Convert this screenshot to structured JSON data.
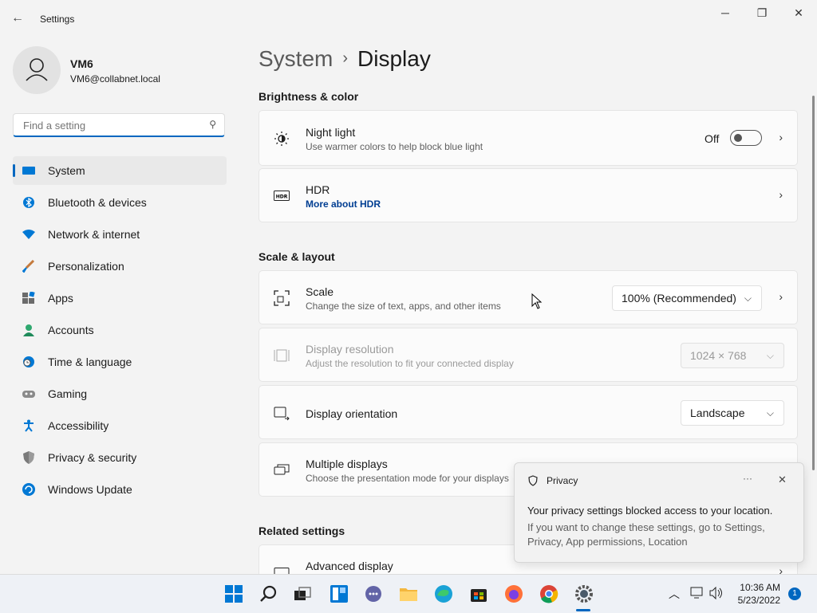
{
  "window": {
    "app_title": "Settings",
    "back_glyph": "←",
    "minimize_glyph": "─",
    "maximize_glyph": "❐",
    "close_glyph": "✕"
  },
  "user": {
    "name": "VM6",
    "email": "VM6@collabnet.local"
  },
  "search": {
    "placeholder": "Find a setting"
  },
  "sidebar": {
    "items": [
      {
        "label": "System",
        "icon": "monitor-icon",
        "selected": true
      },
      {
        "label": "Bluetooth & devices",
        "icon": "bluetooth-icon"
      },
      {
        "label": "Network & internet",
        "icon": "wifi-icon"
      },
      {
        "label": "Personalization",
        "icon": "paintbrush-icon"
      },
      {
        "label": "Apps",
        "icon": "apps-icon"
      },
      {
        "label": "Accounts",
        "icon": "person-icon"
      },
      {
        "label": "Time & language",
        "icon": "clock-globe-icon"
      },
      {
        "label": "Gaming",
        "icon": "gamepad-icon"
      },
      {
        "label": "Accessibility",
        "icon": "accessibility-icon"
      },
      {
        "label": "Privacy & security",
        "icon": "shield-icon"
      },
      {
        "label": "Windows Update",
        "icon": "update-icon"
      }
    ]
  },
  "breadcrumb": {
    "parent": "System",
    "separator": "›",
    "current": "Display"
  },
  "sections": {
    "brightness": "Brightness & color",
    "scale_layout": "Scale & layout",
    "related": "Related settings"
  },
  "cards": {
    "night_light": {
      "title": "Night light",
      "subtitle": "Use warmer colors to help block blue light",
      "state": "Off",
      "on": false
    },
    "hdr": {
      "title": "HDR",
      "link": "More about HDR"
    },
    "scale": {
      "title": "Scale",
      "subtitle": "Change the size of text, apps, and other items",
      "value": "100% (Recommended)"
    },
    "resolution": {
      "title": "Display resolution",
      "subtitle": "Adjust the resolution to fit your connected display",
      "value": "1024 × 768",
      "disabled": true
    },
    "orientation": {
      "title": "Display orientation",
      "value": "Landscape"
    },
    "multiple": {
      "title": "Multiple displays",
      "subtitle": "Choose the presentation mode for your displays"
    },
    "advanced": {
      "title": "Advanced display"
    }
  },
  "toast": {
    "title": "Privacy",
    "more_glyph": "···",
    "close_glyph": "✕",
    "message": "Your privacy settings blocked access to your location.",
    "body": "If you want to change these settings, go to Settings, Privacy, App permissions, Location"
  },
  "taskbar": {
    "time": "10:36 AM",
    "date": "5/23/2022",
    "notification_count": "1",
    "apps": [
      "start-icon",
      "search-icon",
      "task-view-icon",
      "widgets-icon",
      "chat-icon",
      "file-explorer-icon",
      "edge-icon",
      "store-icon",
      "firefox-icon",
      "chrome-icon",
      "settings-icon"
    ]
  },
  "colors": {
    "accent": "#0067c0",
    "link": "#003e92"
  }
}
